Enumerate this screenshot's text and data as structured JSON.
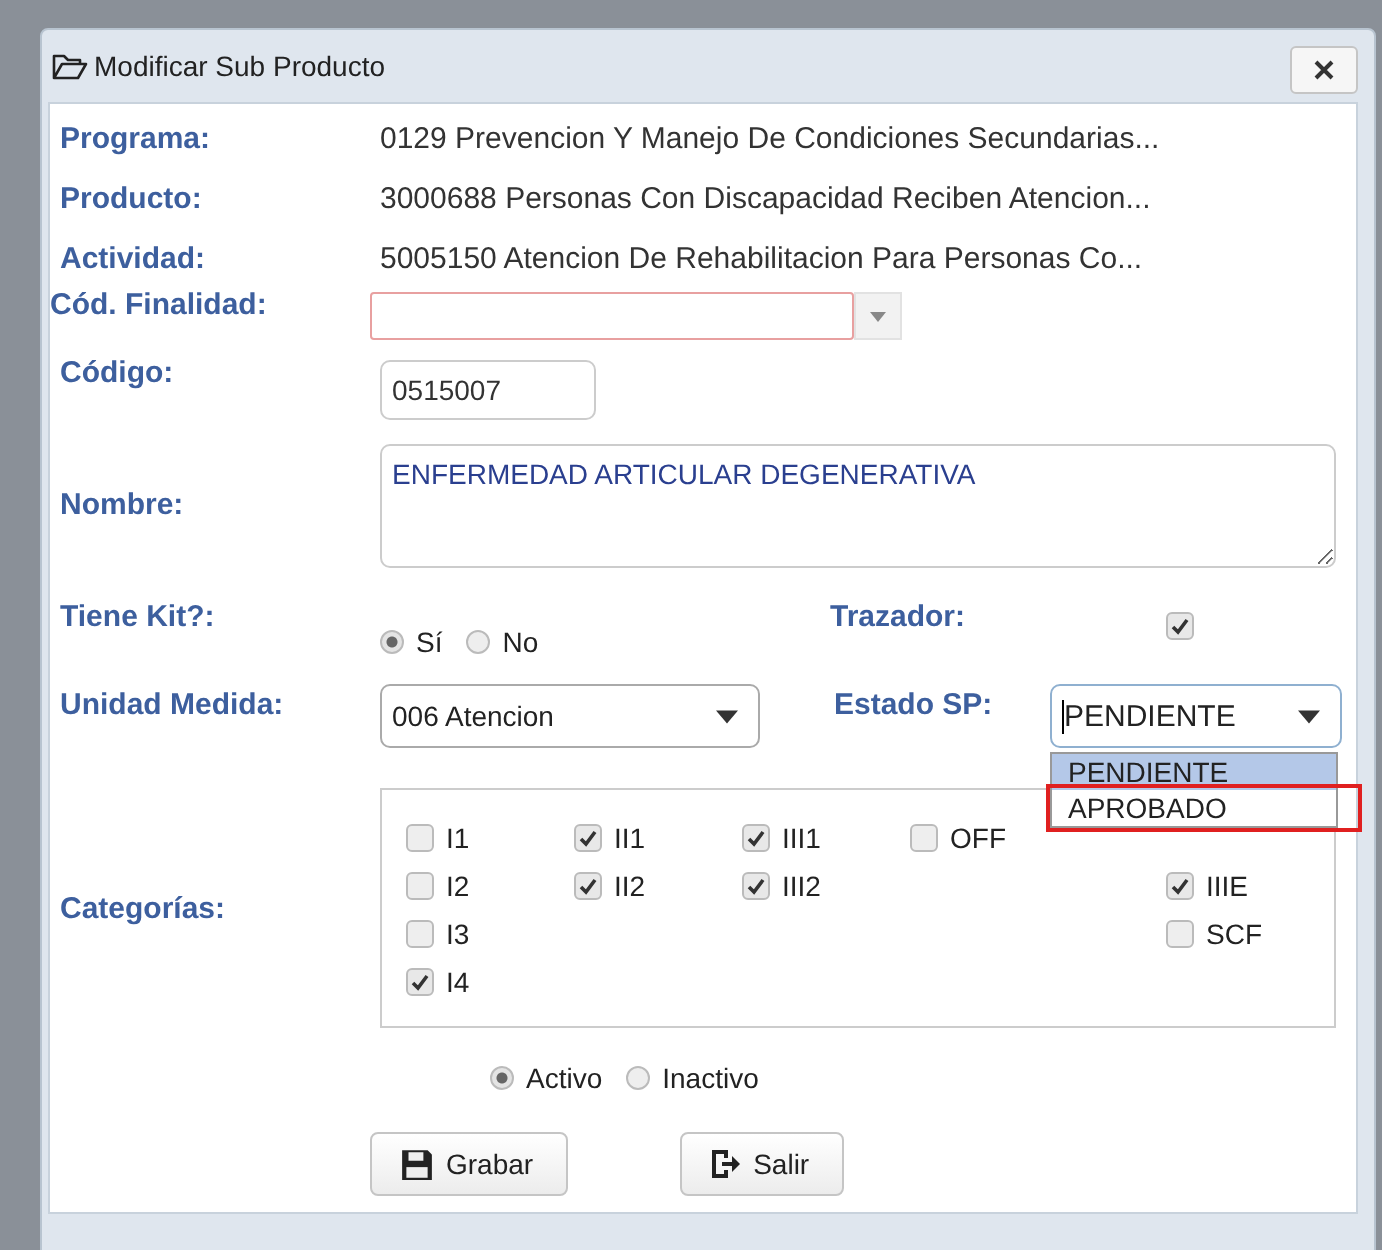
{
  "dialog": {
    "title": "Modificar Sub Producto"
  },
  "info": [
    {
      "label": "Programa:",
      "value": "0129 Prevencion Y Manejo De Condiciones Secundarias..."
    },
    {
      "label": "Producto:",
      "value": "3000688 Personas Con Discapacidad Reciben Atencion..."
    },
    {
      "label": "Actividad:",
      "value": "5005150 Atencion De Rehabilitacion Para Personas Co..."
    }
  ],
  "cod_finalidad": {
    "label": "Cód. Finalidad:",
    "invalid": true
  },
  "codigo": {
    "label": "Código:",
    "value": "0515007"
  },
  "nombre": {
    "label": "Nombre:",
    "value": "ENFERMEDAD ARTICULAR DEGENERATIVA"
  },
  "tiene_kit": {
    "label": "Tiene Kit?:",
    "options": [
      {
        "label": "Sí",
        "selected": true
      },
      {
        "label": "No",
        "selected": false
      }
    ]
  },
  "trazador": {
    "label": "Trazador:",
    "checked": true
  },
  "unidad_medida": {
    "label": "Unidad Medida:",
    "value": "006 Atencion"
  },
  "estado_sp": {
    "label": "Estado SP:",
    "value": "PENDIENTE",
    "expanded": true,
    "options": [
      {
        "label": "PENDIENTE",
        "selected": true,
        "annotated": false
      },
      {
        "label": "APROBADO",
        "selected": false,
        "annotated": true
      }
    ]
  },
  "categorias": {
    "label": "Categorías:",
    "columns": [
      [
        {
          "label": "I1",
          "checked": false
        },
        {
          "label": "I2",
          "checked": false
        },
        {
          "label": "I3",
          "checked": false
        },
        {
          "label": "I4",
          "checked": true
        }
      ],
      [
        {
          "label": "II1",
          "checked": true
        },
        {
          "label": "II2",
          "checked": true
        }
      ],
      [
        {
          "label": "III1",
          "checked": true
        },
        {
          "label": "III2",
          "checked": true
        }
      ],
      [
        {
          "label": "OFF",
          "checked": false
        }
      ],
      [
        {
          "label": "IIIE",
          "checked": true
        },
        {
          "label": "SCF",
          "checked": false
        }
      ]
    ]
  },
  "estado": {
    "options": [
      {
        "label": "Activo",
        "selected": true
      },
      {
        "label": "Inactivo",
        "selected": false
      }
    ]
  },
  "buttons": [
    {
      "label": "Grabar",
      "kind": "save"
    },
    {
      "label": "Salir",
      "kind": "exit"
    }
  ]
}
